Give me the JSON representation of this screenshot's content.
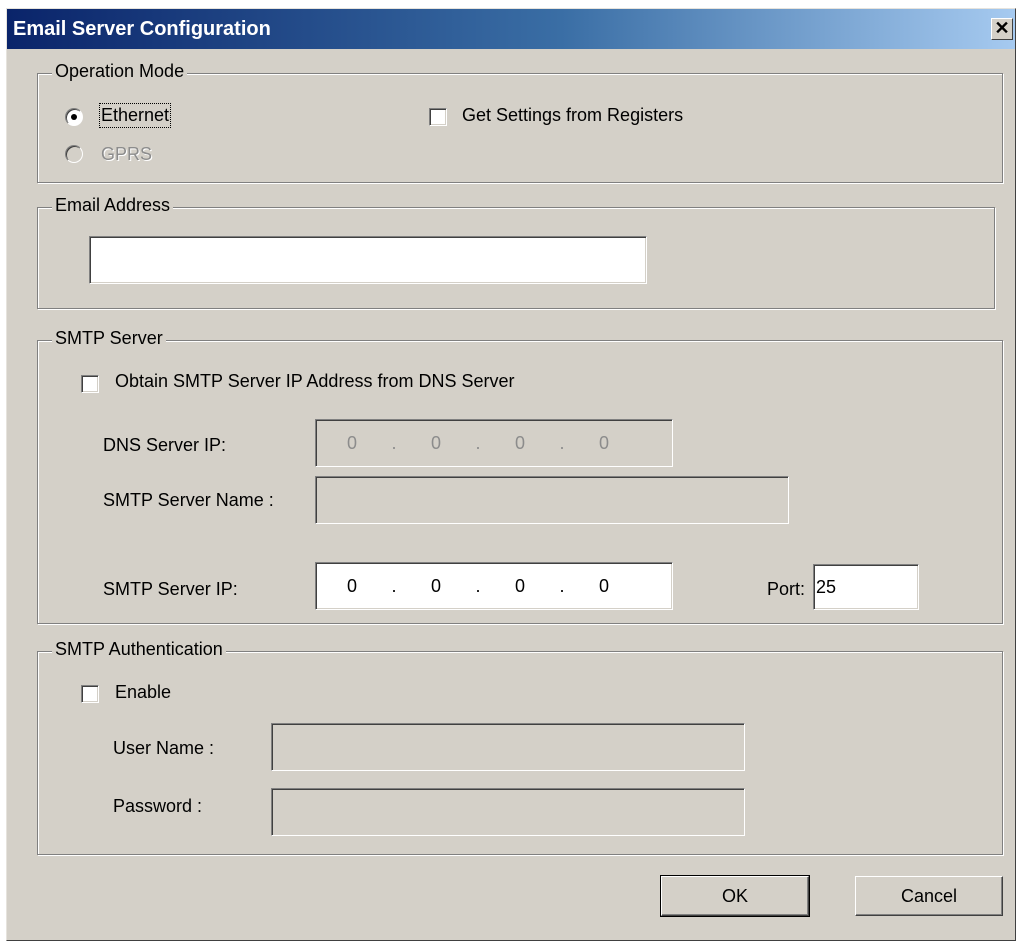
{
  "window": {
    "title": "Email Server Configuration",
    "close_glyph": "✕"
  },
  "operation_mode": {
    "legend": "Operation Mode",
    "ethernet_label": "Ethernet",
    "ethernet_selected": true,
    "gprs_label": "GPRS",
    "gprs_enabled": false,
    "get_settings_label": "Get Settings from Registers",
    "get_settings_checked": false
  },
  "email_address": {
    "legend": "Email Address",
    "value": ""
  },
  "smtp_server": {
    "legend": "SMTP Server",
    "obtain_dns_label": "Obtain SMTP Server IP Address from DNS Server",
    "obtain_dns_checked": false,
    "dns_ip_label": "DNS Server IP:",
    "dns_ip": [
      "0",
      "0",
      "0",
      "0"
    ],
    "server_name_label": "SMTP Server Name :",
    "server_name_value": "",
    "server_ip_label": "SMTP Server IP:",
    "server_ip": [
      "0",
      "0",
      "0",
      "0"
    ],
    "port_label": "Port:",
    "port_value": "25"
  },
  "smtp_auth": {
    "legend": "SMTP Authentication",
    "enable_label": "Enable",
    "enable_checked": false,
    "username_label": "User Name :",
    "username_value": "",
    "password_label": "Password :",
    "password_value": ""
  },
  "buttons": {
    "ok": "OK",
    "cancel": "Cancel"
  },
  "ip_separator": "."
}
